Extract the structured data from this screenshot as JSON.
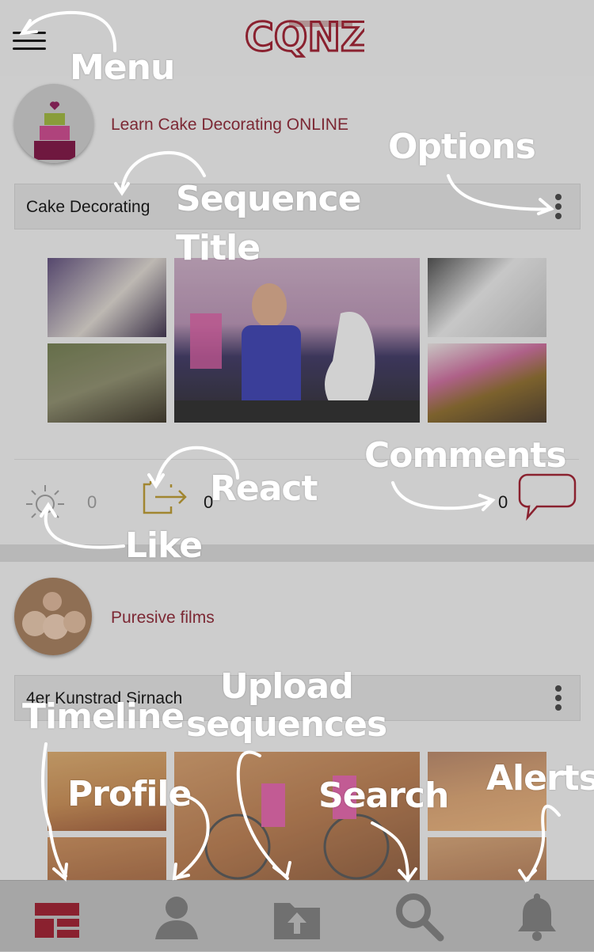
{
  "app": {
    "logo_text": "CQNZ"
  },
  "posts": [
    {
      "channel": "Learn Cake Decorating ONLINE",
      "sequence_title": "Cake Decorating",
      "likes": "0",
      "reactions": "0",
      "comments": "0"
    },
    {
      "channel": "Puresive films",
      "sequence_title": "4er Kunstrad Sirnach"
    }
  ],
  "annotations": {
    "menu": "Menu",
    "options": "Options",
    "sequence_title_line1": "Sequence",
    "sequence_title_line2": "Title",
    "comments": "Comments",
    "react": "React",
    "like": "Like",
    "timeline": "Timeline",
    "upload_line1": "Upload",
    "upload_line2": "sequences",
    "profile": "Profile",
    "search": "Search",
    "alerts": "Alerts"
  },
  "icons": {
    "menu": "hamburger-icon",
    "options": "vertical-dots-icon",
    "like": "sun-icon",
    "react": "share-arrow-icon",
    "comment": "speech-bubble-icon",
    "timeline": "grid-icon",
    "profile": "user-icon",
    "upload": "upload-folder-icon",
    "search": "search-icon",
    "alerts": "bell-icon"
  },
  "colors": {
    "accent": "#9b1c2c",
    "channel_text": "#8a2432",
    "react_icon": "#b8962e"
  }
}
